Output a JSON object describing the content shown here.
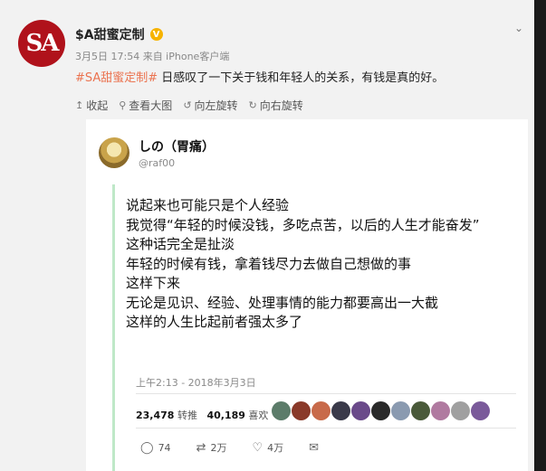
{
  "post": {
    "author": "$A甜蜜定制",
    "verified_mark": "V",
    "avatar_text": "SA",
    "meta": "3月5日 17:54 来自 iPhone客户端",
    "hashtag": "#SA甜蜜定制#",
    "text": " 日感叹了一下关于钱和年轻人的关系，有钱是真的好。",
    "menu_icon": "chevron-down-icon"
  },
  "toolbar": {
    "items": [
      {
        "icon": "collapse-icon",
        "glyph": "↥",
        "label": "收起"
      },
      {
        "icon": "zoom-icon",
        "glyph": "⚲",
        "label": "查看大图"
      },
      {
        "icon": "rotate-left-icon",
        "glyph": "↺",
        "label": "向左旋转"
      },
      {
        "icon": "rotate-right-icon",
        "glyph": "↻",
        "label": "向右旋转"
      }
    ]
  },
  "embedded": {
    "name": "しの（胃痛）",
    "handle": "@raf00",
    "lines": [
      "说起来也可能只是个人经验",
      "我觉得“年轻的时候没钱，多吃点苦，以后的人生才能奋发”",
      "这种话完全是扯淡",
      "年轻的时候有钱，拿着钱尽力去做自己想做的事",
      "这样下来",
      "无论是见识、经验、处理事情的能力都要高出一大截",
      "这样的人生比起前者强太多了"
    ],
    "timestamp": "上午2:13 - 2018年3月3日",
    "retweet_count": "23,478",
    "retweet_label": "转推",
    "like_count": "40,189",
    "like_label": "喜欢",
    "likers": [
      "#5c7c6a",
      "#8a3a2a",
      "#c86a4a",
      "#3a3a4a",
      "#6a4a8a",
      "#2a2a2a",
      "#8a9ab0",
      "#4a5a3a",
      "#b07aa0",
      "#a0a0a0",
      "#7a5a9a"
    ],
    "actions": {
      "reply": {
        "glyph": "◯",
        "count": "74"
      },
      "retweet": {
        "glyph": "⇄",
        "count": "2万"
      },
      "like": {
        "glyph": "♡",
        "count": "4万"
      },
      "message": {
        "glyph": "✉",
        "count": ""
      }
    }
  }
}
